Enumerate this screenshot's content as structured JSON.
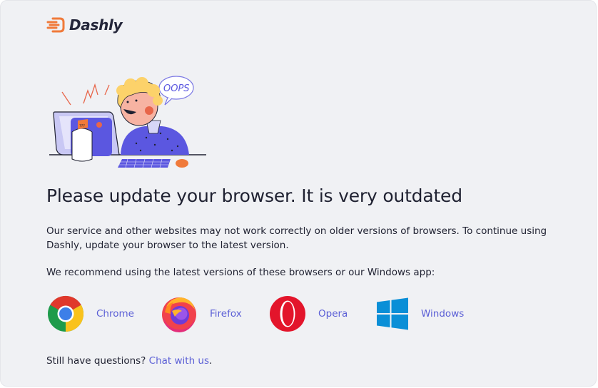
{
  "brand": {
    "name": "Dashly",
    "accent": "#f07a3a"
  },
  "illustration": {
    "bubble_text": "OOPS",
    "note_text": "???"
  },
  "main": {
    "title": "Please update your browser. It is very outdated",
    "description": "Our service and other websites may not work correctly on older versions of browsers. To continue using Dashly, update your browser to the latest version.",
    "recommend": "We recommend using the latest versions of these browsers or our Windows app:"
  },
  "browsers": [
    {
      "label": "Chrome",
      "icon": "chrome-icon"
    },
    {
      "label": "Firefox",
      "icon": "firefox-icon"
    },
    {
      "label": "Opera",
      "icon": "opera-icon"
    },
    {
      "label": "Windows",
      "icon": "windows-icon"
    }
  ],
  "footer": {
    "question": "Still have questions?",
    "link": "Chat with us",
    "period": "."
  },
  "colors": {
    "link": "#5b5fd6",
    "panel_bg": "#f0f1f4",
    "text": "#1f2131"
  }
}
